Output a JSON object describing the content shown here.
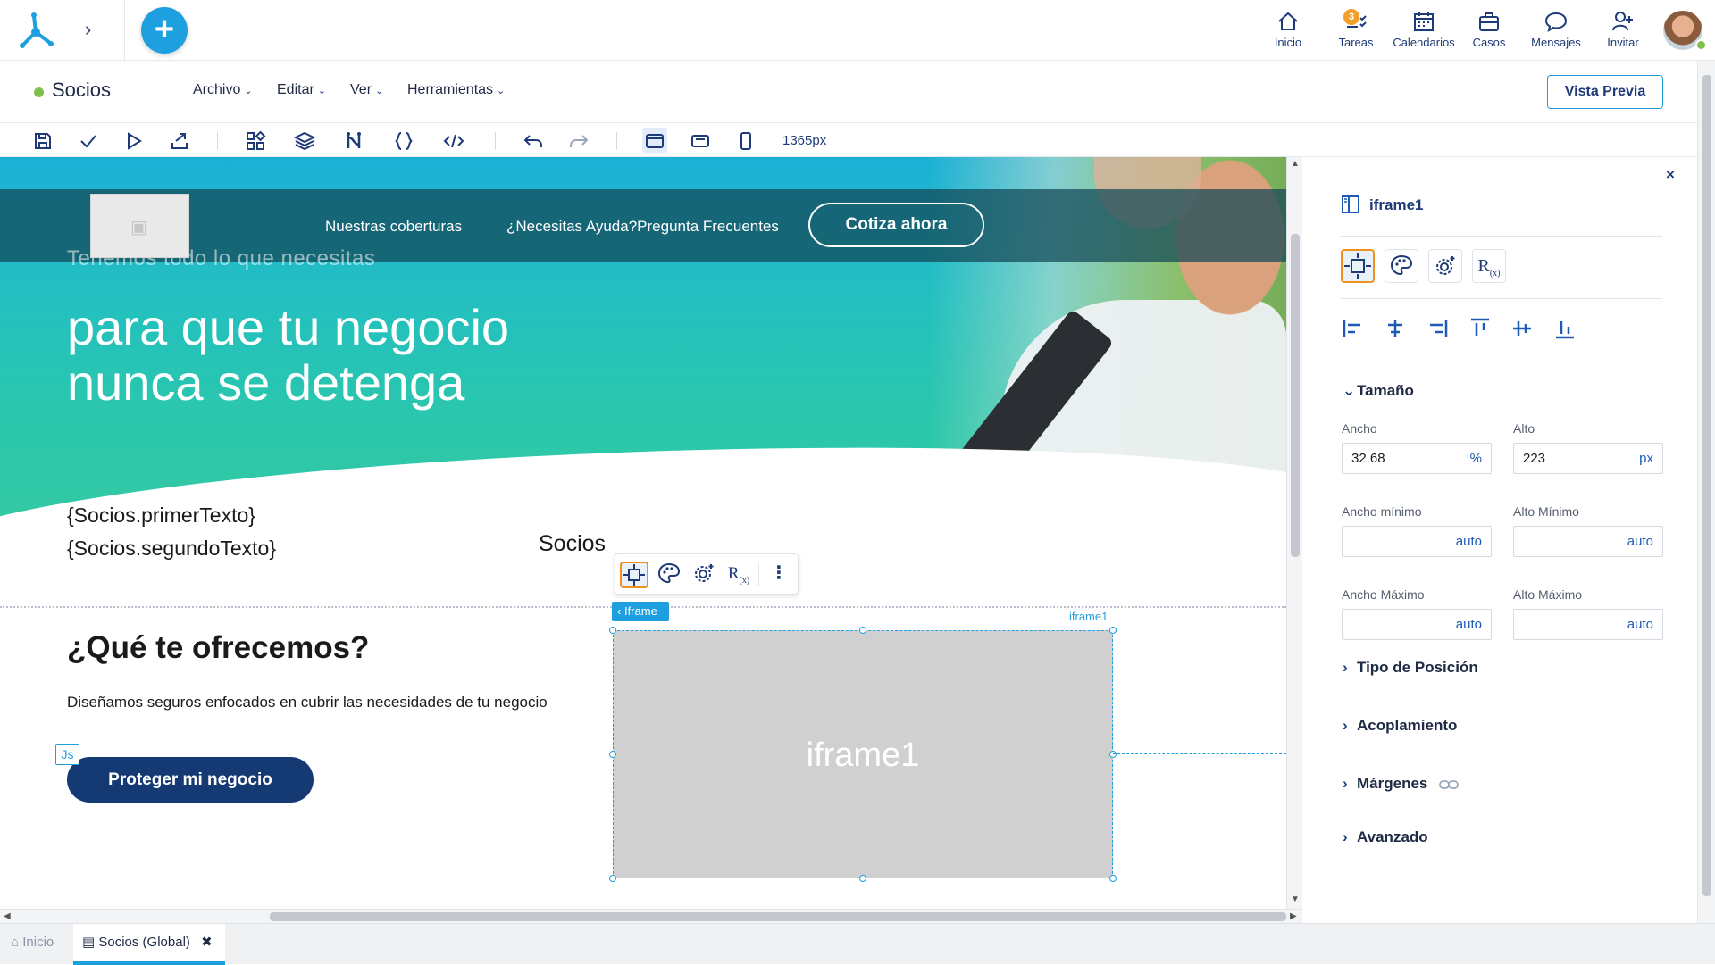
{
  "topnav": [
    {
      "name": "nav-inicio",
      "icon": "home-icon",
      "label": "Inicio"
    },
    {
      "name": "nav-tareas",
      "icon": "tasks-icon",
      "label": "Tareas",
      "badge": "3"
    },
    {
      "name": "nav-calendarios",
      "icon": "calendar-icon",
      "label": "Calendarios"
    },
    {
      "name": "nav-casos",
      "icon": "briefcase-icon",
      "label": "Casos"
    },
    {
      "name": "nav-mensajes",
      "icon": "chat-icon",
      "label": "Mensajes"
    },
    {
      "name": "nav-invitar",
      "icon": "invite-user-icon",
      "label": "Invitar"
    }
  ],
  "colors": {
    "accent": "#1e9fe0",
    "brand_dark": "#1e3a78",
    "status_online": "#7fc04b",
    "badge": "#f2a02c",
    "highlight": "#f0901e"
  },
  "header": {
    "title": "Socios",
    "menus": [
      "Archivo",
      "Editar",
      "Ver",
      "Herramientas"
    ],
    "preview_label": "Vista Previa"
  },
  "toolbar": {
    "width_readout": "1365px",
    "icons": [
      "save-icon",
      "check-icon",
      "play-icon",
      "publish-icon",
      "components-icon",
      "layers-icon",
      "flow-icon",
      "braces-icon",
      "code-icon",
      "undo-icon",
      "redo-icon",
      "desktop-view-icon",
      "tablet-view-icon",
      "mobile-view-icon"
    ]
  },
  "canvas": {
    "site_nav": [
      "Nuestras coberturas",
      "¿Necesitas Ayuda?Pregunta Frecuentes"
    ],
    "cta_outline": "Cotiza ahora",
    "hero_small": "Tenemos todo lo que necesitas",
    "hero_big_1": "para que tu negocio",
    "hero_big_2": "nunca se detenga",
    "template_text_1": "{Socios.primerTexto}",
    "template_text_2": "{Socios.segundoTexto}",
    "socios_label": "Socios",
    "iframe_chip": "Iframe",
    "iframe_name": "iframe1",
    "iframe_placeholder": "iframe1",
    "offer_title": "¿Qué te ofrecemos?",
    "offer_text": "Diseñamos seguros enfocados en cubrir las necesidades de tu negocio",
    "js_chip": "Js",
    "cta_solid": "Proteger mi negocio"
  },
  "panel": {
    "title": "iframe1",
    "close": "×",
    "section_size": "Tamaño",
    "fields": {
      "ancho_label": "Ancho",
      "ancho_value": "32.68",
      "ancho_unit": "%",
      "alto_label": "Alto",
      "alto_value": "223",
      "alto_unit": "px",
      "ancho_min_label": "Ancho mínimo",
      "ancho_min_value": "auto",
      "alto_min_label": "Alto Mínimo",
      "alto_min_value": "auto",
      "ancho_max_label": "Ancho Máximo",
      "ancho_max_value": "auto",
      "alto_max_label": "Alto Máximo",
      "alto_max_value": "auto"
    },
    "sections": [
      "Tipo de Posición",
      "Acoplamiento",
      "Márgenes",
      "Avanzado"
    ]
  },
  "bottom_tabs": [
    {
      "label": "Inicio",
      "active": false
    },
    {
      "label": "Socios (Global)",
      "active": true
    }
  ]
}
